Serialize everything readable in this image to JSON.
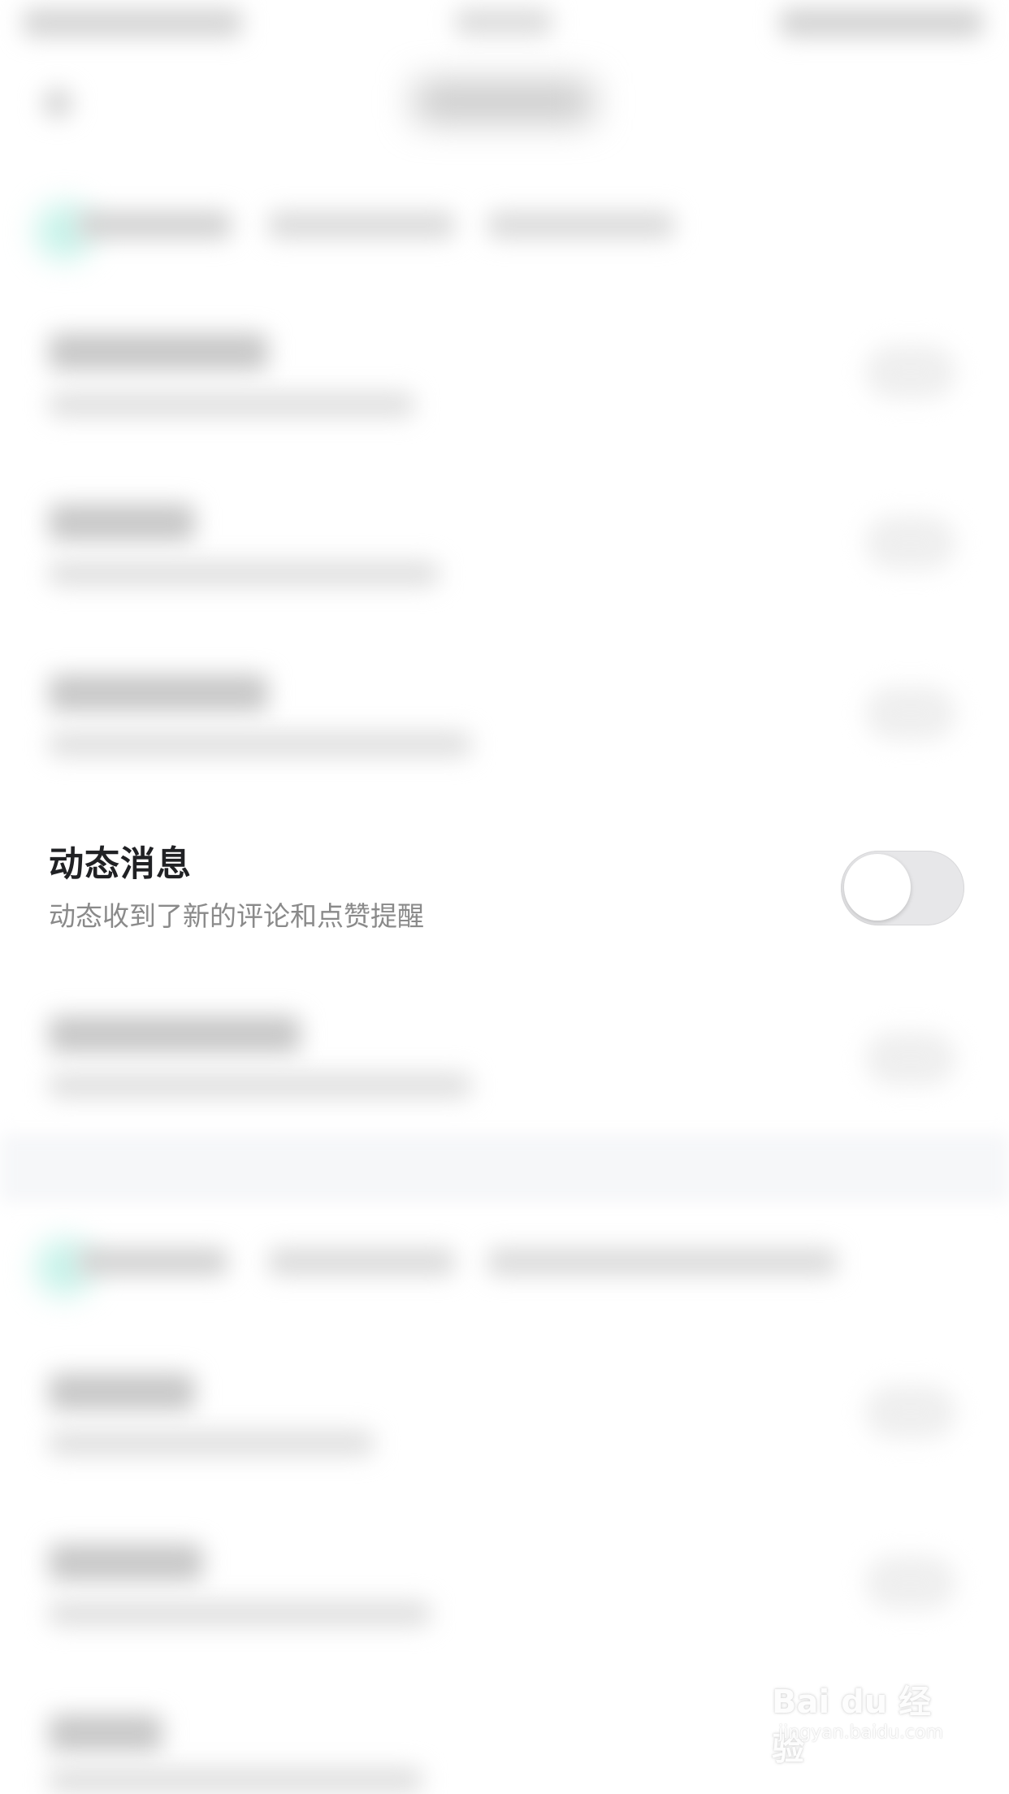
{
  "focused_setting": {
    "title": "动态消息",
    "description": "动态收到了新的评论和点赞提醒",
    "enabled": false
  },
  "watermark": {
    "brand": "Bai du 经验",
    "url": "jingyan.baidu.com"
  },
  "colors": {
    "background": "#ffffff",
    "title_text": "#202124",
    "description_text": "#8a8a8a",
    "switch_track": "#e7e7e9",
    "switch_knob": "#ffffff"
  }
}
